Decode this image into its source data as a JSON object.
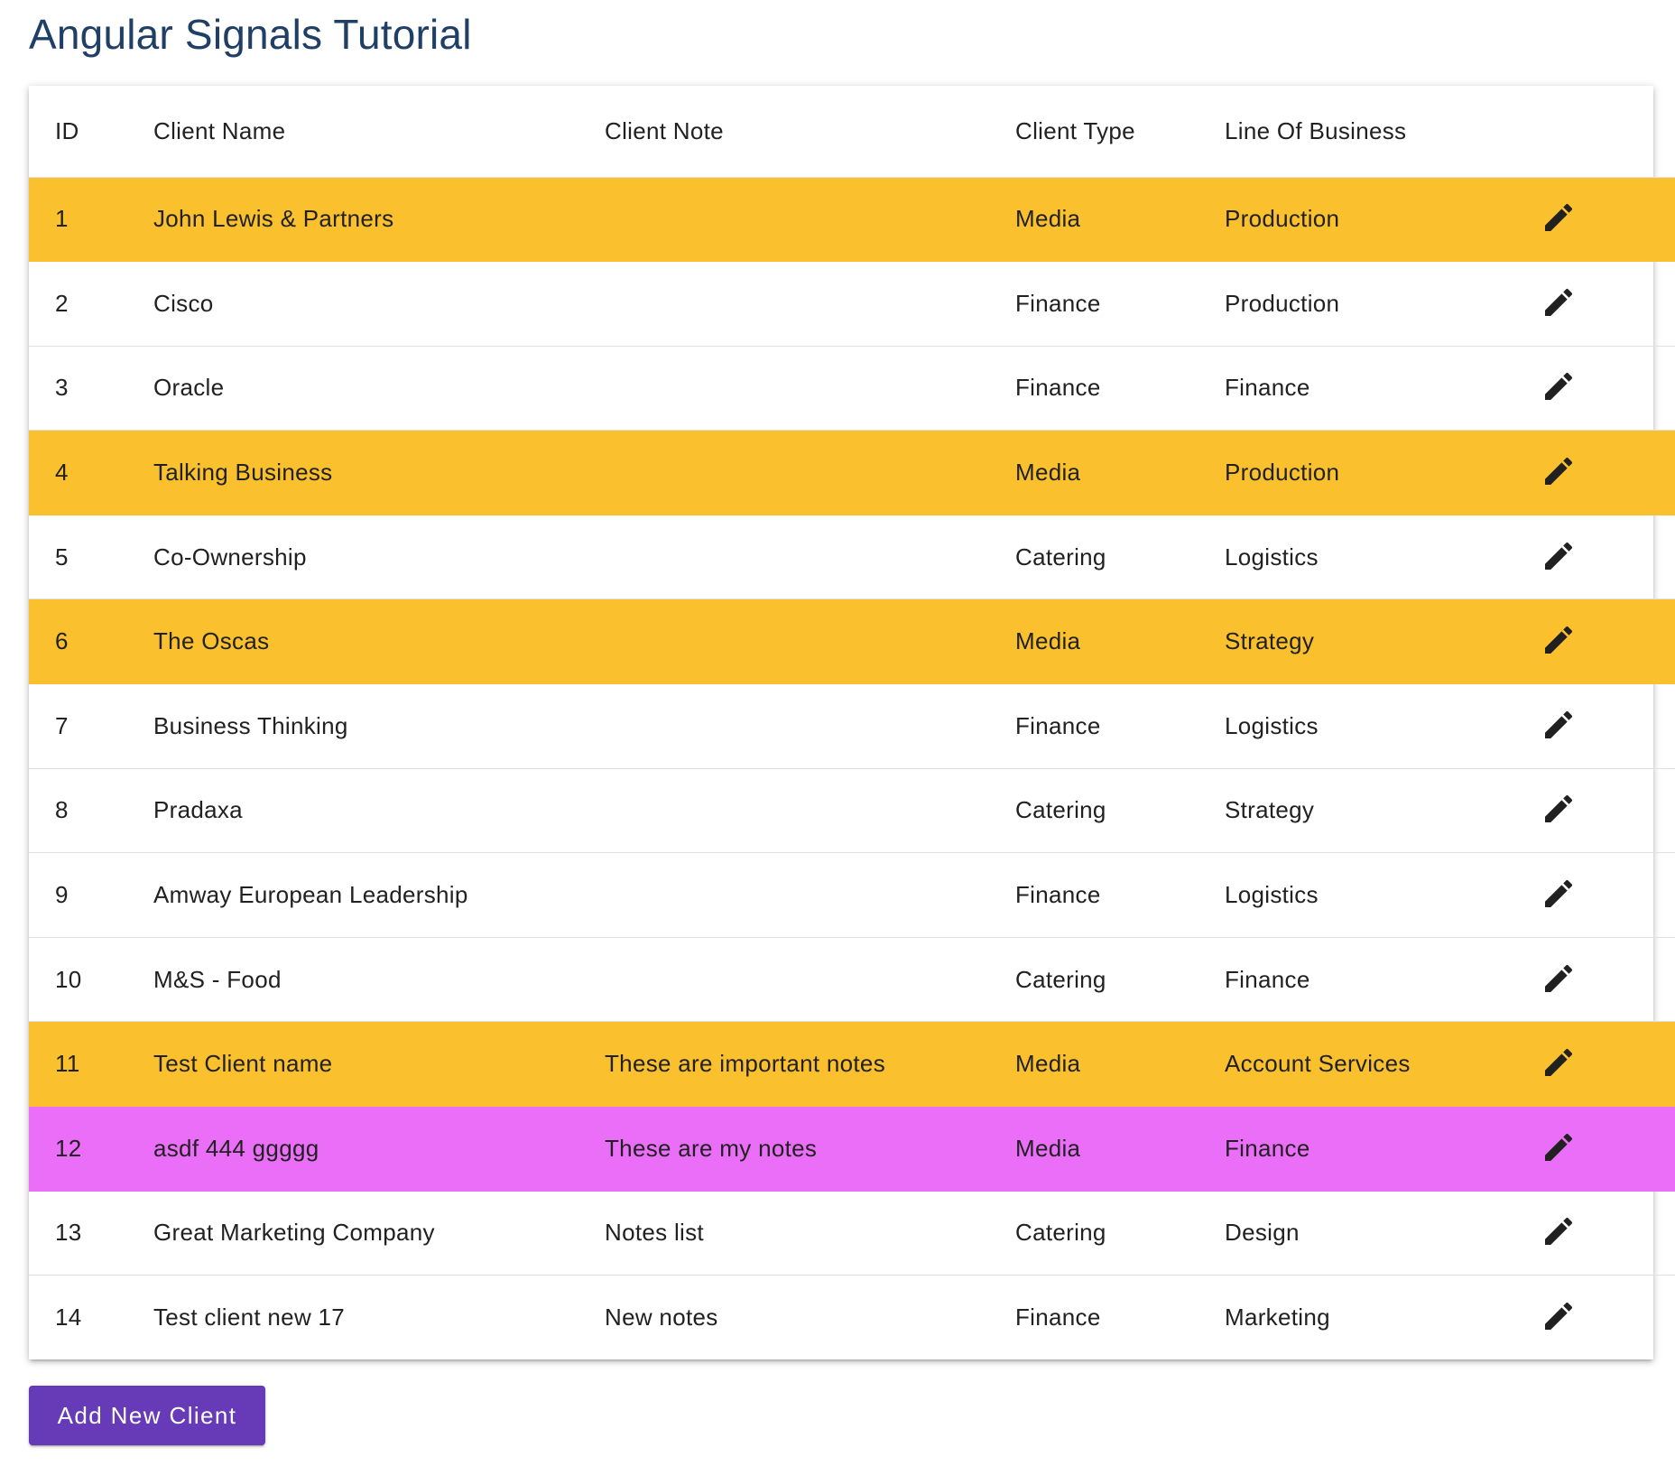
{
  "page": {
    "title": "Angular Signals Tutorial"
  },
  "table": {
    "headers": {
      "id": "ID",
      "name": "Client Name",
      "note": "Client Note",
      "type": "Client Type",
      "lob": "Line Of Business"
    },
    "rows": [
      {
        "id": "1",
        "name": "John Lewis & Partners",
        "note": "",
        "type": "Media",
        "lob": "Production"
      },
      {
        "id": "2",
        "name": "Cisco",
        "note": "",
        "type": "Finance",
        "lob": "Production"
      },
      {
        "id": "3",
        "name": "Oracle",
        "note": "",
        "type": "Finance",
        "lob": "Finance"
      },
      {
        "id": "4",
        "name": "Talking Business",
        "note": "",
        "type": "Media",
        "lob": "Production"
      },
      {
        "id": "5",
        "name": "Co-Ownership",
        "note": "",
        "type": "Catering",
        "lob": "Logistics"
      },
      {
        "id": "6",
        "name": "The Oscas",
        "note": "",
        "type": "Media",
        "lob": "Strategy"
      },
      {
        "id": "7",
        "name": "Business Thinking",
        "note": "",
        "type": "Finance",
        "lob": "Logistics"
      },
      {
        "id": "8",
        "name": "Pradaxa",
        "note": "",
        "type": "Catering",
        "lob": "Strategy"
      },
      {
        "id": "9",
        "name": "Amway European Leadership",
        "note": "",
        "type": "Finance",
        "lob": "Logistics"
      },
      {
        "id": "10",
        "name": "M&S - Food",
        "note": "",
        "type": "Catering",
        "lob": "Finance"
      },
      {
        "id": "11",
        "name": "Test Client name",
        "note": "These are important notes",
        "type": "Media",
        "lob": "Account Services"
      },
      {
        "id": "12",
        "name": "asdf 444 ggggg",
        "note": "These are my notes",
        "type": "Media",
        "lob": "Finance"
      },
      {
        "id": "13",
        "name": "Great Marketing Company",
        "note": "Notes list",
        "type": "Catering",
        "lob": "Design"
      },
      {
        "id": "14",
        "name": "Test client new 17",
        "note": "New notes",
        "type": "Finance",
        "lob": "Marketing"
      }
    ],
    "edit_icon": "pencil-icon"
  },
  "actions": {
    "add_label": "Add New Client"
  },
  "colors": {
    "title": "#1f3f66",
    "media_highlight": "#fbc02d",
    "selected_highlight": "#eb6ef9",
    "primary_button": "#673ab7"
  }
}
